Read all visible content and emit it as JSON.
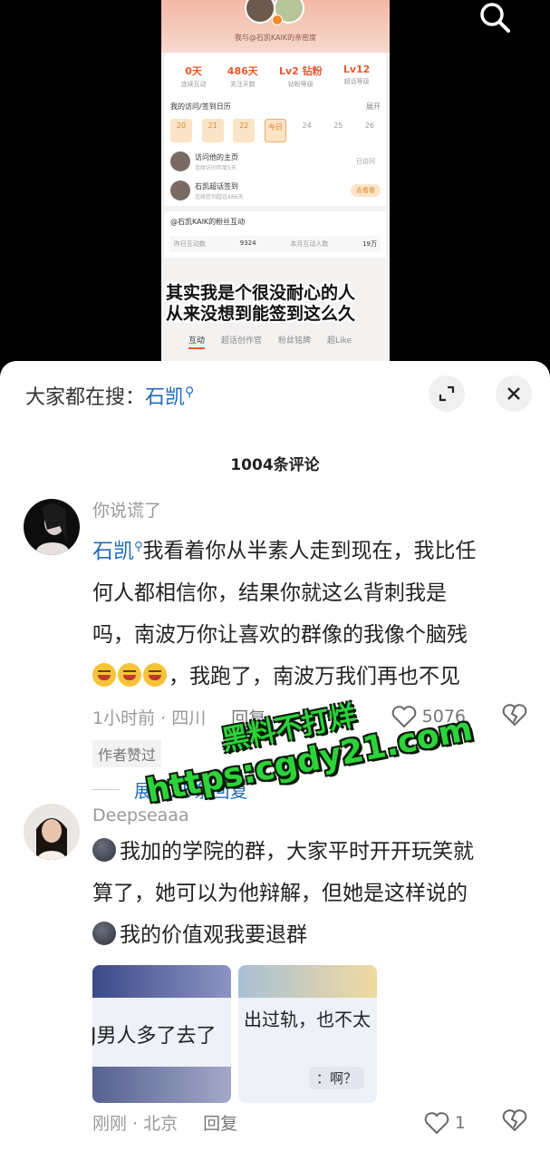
{
  "video": {
    "caption_line1": "其实我是个很没耐心的人",
    "caption_line2": "从来没想到能签到这么久",
    "frame": {
      "subtitle_top": "我与@石凯KAIK的亲密度",
      "stats": [
        {
          "value": "0天",
          "label": "连续互动"
        },
        {
          "value": "486天",
          "label": "关注天数"
        },
        {
          "value": "Lv2 钻粉",
          "label": "钻粉等级"
        },
        {
          "value": "Lv12",
          "label": "超话等级"
        }
      ],
      "calendar_title": "我的访问/签到日历",
      "calendar_more": "展开",
      "days": [
        "20",
        "21",
        "22",
        "今日",
        "24",
        "25",
        "26"
      ],
      "items": [
        {
          "title": "访问他的主页",
          "sub": "连续访问年度5天",
          "btn": "已访问"
        },
        {
          "title": "石凯超话签到",
          "sub": "连续签到超话486天",
          "btn": "去看看"
        }
      ],
      "fans_title": "@石凯KAIK的粉丝互动",
      "fans_row": {
        "l1": "昨日互动数",
        "v1": "9324",
        "l2": "本月互动人数",
        "v2": "19万"
      },
      "tabs": [
        "互动",
        "超话创作官",
        "粉丝铭牌",
        "超Like"
      ]
    }
  },
  "search": {
    "prefix": "大家都在搜：",
    "term": "石凯"
  },
  "comments_count": "1004条评论",
  "comments": [
    {
      "name": "你说谎了",
      "mention": "石凯",
      "text_lines": [
        "我看着你从半素人走到现在，我比任",
        "何人都相信你，结果你就这么背刺我是",
        "吗，南波万你让喜欢的群像的我像个脑残"
      ],
      "last_line_text": "，我跑了，南波万我们再也不见",
      "time_loc": "1小时前 · 四川",
      "reply": "回复",
      "likes": "5076",
      "author_tag": "作者赞过",
      "expand": "展开25条回复"
    },
    {
      "name": "Deepseaaa",
      "line1": "我加的学院的群，大家平时开开玩笑就",
      "line2": "算了，她可以为他辩解，但她是这样说的",
      "line3": "我的价值观我要退群",
      "thumb1_text": "J男人多了去了",
      "thumb2_text": "出过轨，也不太",
      "thumb2_sub": "：啊？",
      "time_loc": "刚刚 · 北京",
      "reply": "回复",
      "likes": "1"
    }
  ],
  "watermark": {
    "line1": "黑料不打烊",
    "line2": "https:cgdy21.com"
  },
  "colors": {
    "accent": "#1f6bb8",
    "watermark": "#2cd33a"
  }
}
